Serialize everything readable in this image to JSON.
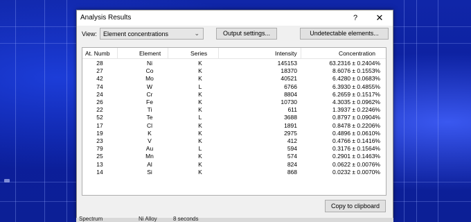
{
  "dialog": {
    "title": "Analysis Results",
    "help_label": "?",
    "close_label": "✕"
  },
  "toolbar": {
    "view_label": "View:",
    "view_select_value": "Element concentrations",
    "output_settings_label": "Output settings...",
    "undetectable_label": "Undetectable elements..."
  },
  "table": {
    "headers": [
      "At. Numb",
      "Element",
      "Series",
      "Intensity",
      "Concentration"
    ],
    "rows": [
      [
        "28",
        "Ni",
        "K",
        "145153",
        "63.2316 ± 0.2404%"
      ],
      [
        "27",
        "Co",
        "K",
        "18370",
        "8.6076 ± 0.1553%"
      ],
      [
        "42",
        "Mo",
        "K",
        "40521",
        "6.4280 ± 0.0683%"
      ],
      [
        "74",
        "W",
        "L",
        "6766",
        "6.3930 ± 0.4855%"
      ],
      [
        "24",
        "Cr",
        "K",
        "8804",
        "6.2659 ± 0.1517%"
      ],
      [
        "26",
        "Fe",
        "K",
        "10730",
        "4.3035 ± 0.0962%"
      ],
      [
        "22",
        "Ti",
        "K",
        "611",
        "1.3937 ± 0.2246%"
      ],
      [
        "52",
        "Te",
        "L",
        "3688",
        "0.8797 ± 0.0904%"
      ],
      [
        "17",
        "Cl",
        "K",
        "1891",
        "0.8478 ± 0.2206%"
      ],
      [
        "19",
        "K",
        "K",
        "2975",
        "0.4896 ± 0.0610%"
      ],
      [
        "23",
        "V",
        "K",
        "412",
        "0.4766 ± 0.1416%"
      ],
      [
        "79",
        "Au",
        "L",
        "594",
        "0.3176 ± 0.1564%"
      ],
      [
        "25",
        "Mn",
        "K",
        "574",
        "0.2901 ± 0.1463%"
      ],
      [
        "13",
        "Al",
        "K",
        "824",
        "0.0622 ± 0.0076%"
      ],
      [
        "14",
        "Si",
        "K",
        "868",
        "0.0232 ± 0.0070%"
      ]
    ]
  },
  "footer": {
    "copy_label": "Copy to clipboard"
  },
  "statusbar": {
    "left_text": "Spectrum",
    "middle_text": "Ni Alloy",
    "right_text": "8 seconds"
  }
}
